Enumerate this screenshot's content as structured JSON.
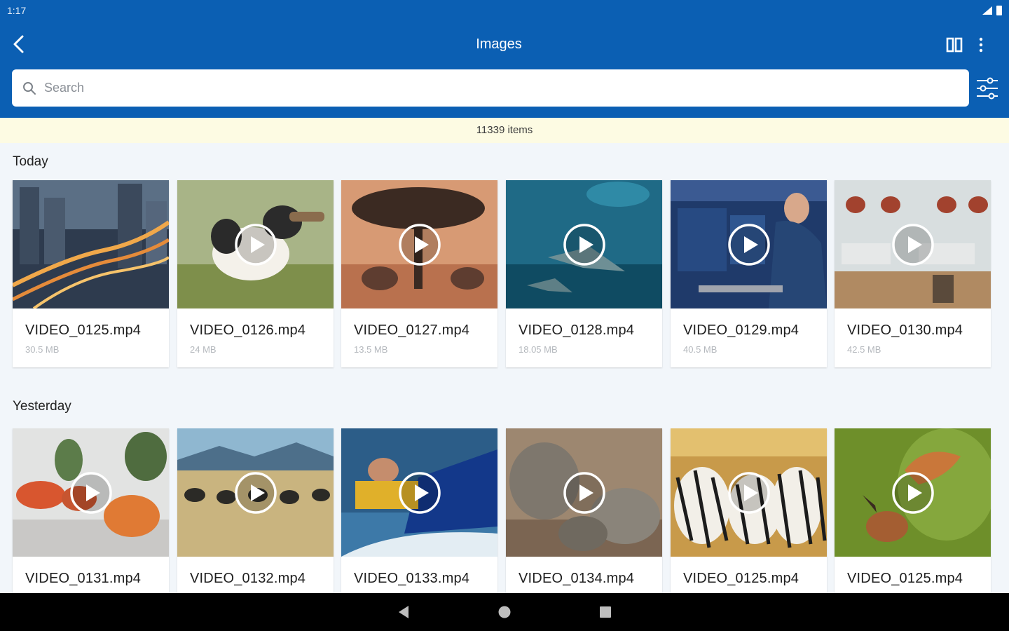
{
  "status": {
    "time": "1:17"
  },
  "header": {
    "title": "Images"
  },
  "search": {
    "placeholder": "Search"
  },
  "banner": {
    "count_text": "11339 items"
  },
  "sections": [
    {
      "title": "Today",
      "items": [
        {
          "name": "VIDEO_0125.mp4",
          "size": "30.5 MB",
          "has_play": false,
          "thumb": "city-highway"
        },
        {
          "name": "VIDEO_0126.mp4",
          "size": "24 MB",
          "has_play": true,
          "thumb": "puppy"
        },
        {
          "name": "VIDEO_0127.mp4",
          "size": "13.5 MB",
          "has_play": true,
          "thumb": "savanna-tree"
        },
        {
          "name": "VIDEO_0128.mp4",
          "size": "18.05 MB",
          "has_play": true,
          "thumb": "stingrays"
        },
        {
          "name": "VIDEO_0129.mp4",
          "size": "40.5 MB",
          "has_play": true,
          "thumb": "office-monitor"
        },
        {
          "name": "VIDEO_0130.mp4",
          "size": "42.5 MB",
          "has_play": true,
          "thumb": "office-lamps"
        }
      ]
    },
    {
      "title": "Yesterday",
      "items": [
        {
          "name": "VIDEO_0131.mp4",
          "size": "",
          "has_play": true,
          "thumb": "lounge-chairs"
        },
        {
          "name": "VIDEO_0132.mp4",
          "size": "",
          "has_play": true,
          "thumb": "ostriches"
        },
        {
          "name": "VIDEO_0133.mp4",
          "size": "",
          "has_play": true,
          "thumb": "jetski"
        },
        {
          "name": "VIDEO_0134.mp4",
          "size": "",
          "has_play": true,
          "thumb": "elephants"
        },
        {
          "name": "VIDEO_0125.mp4",
          "size": "",
          "has_play": true,
          "thumb": "zebras"
        },
        {
          "name": "VIDEO_0125.mp4",
          "size": "",
          "has_play": true,
          "thumb": "birds"
        }
      ]
    }
  ],
  "colors": {
    "appbar": "#0b5fb3",
    "banner": "#fdfbe3",
    "background": "#f2f6fa"
  }
}
